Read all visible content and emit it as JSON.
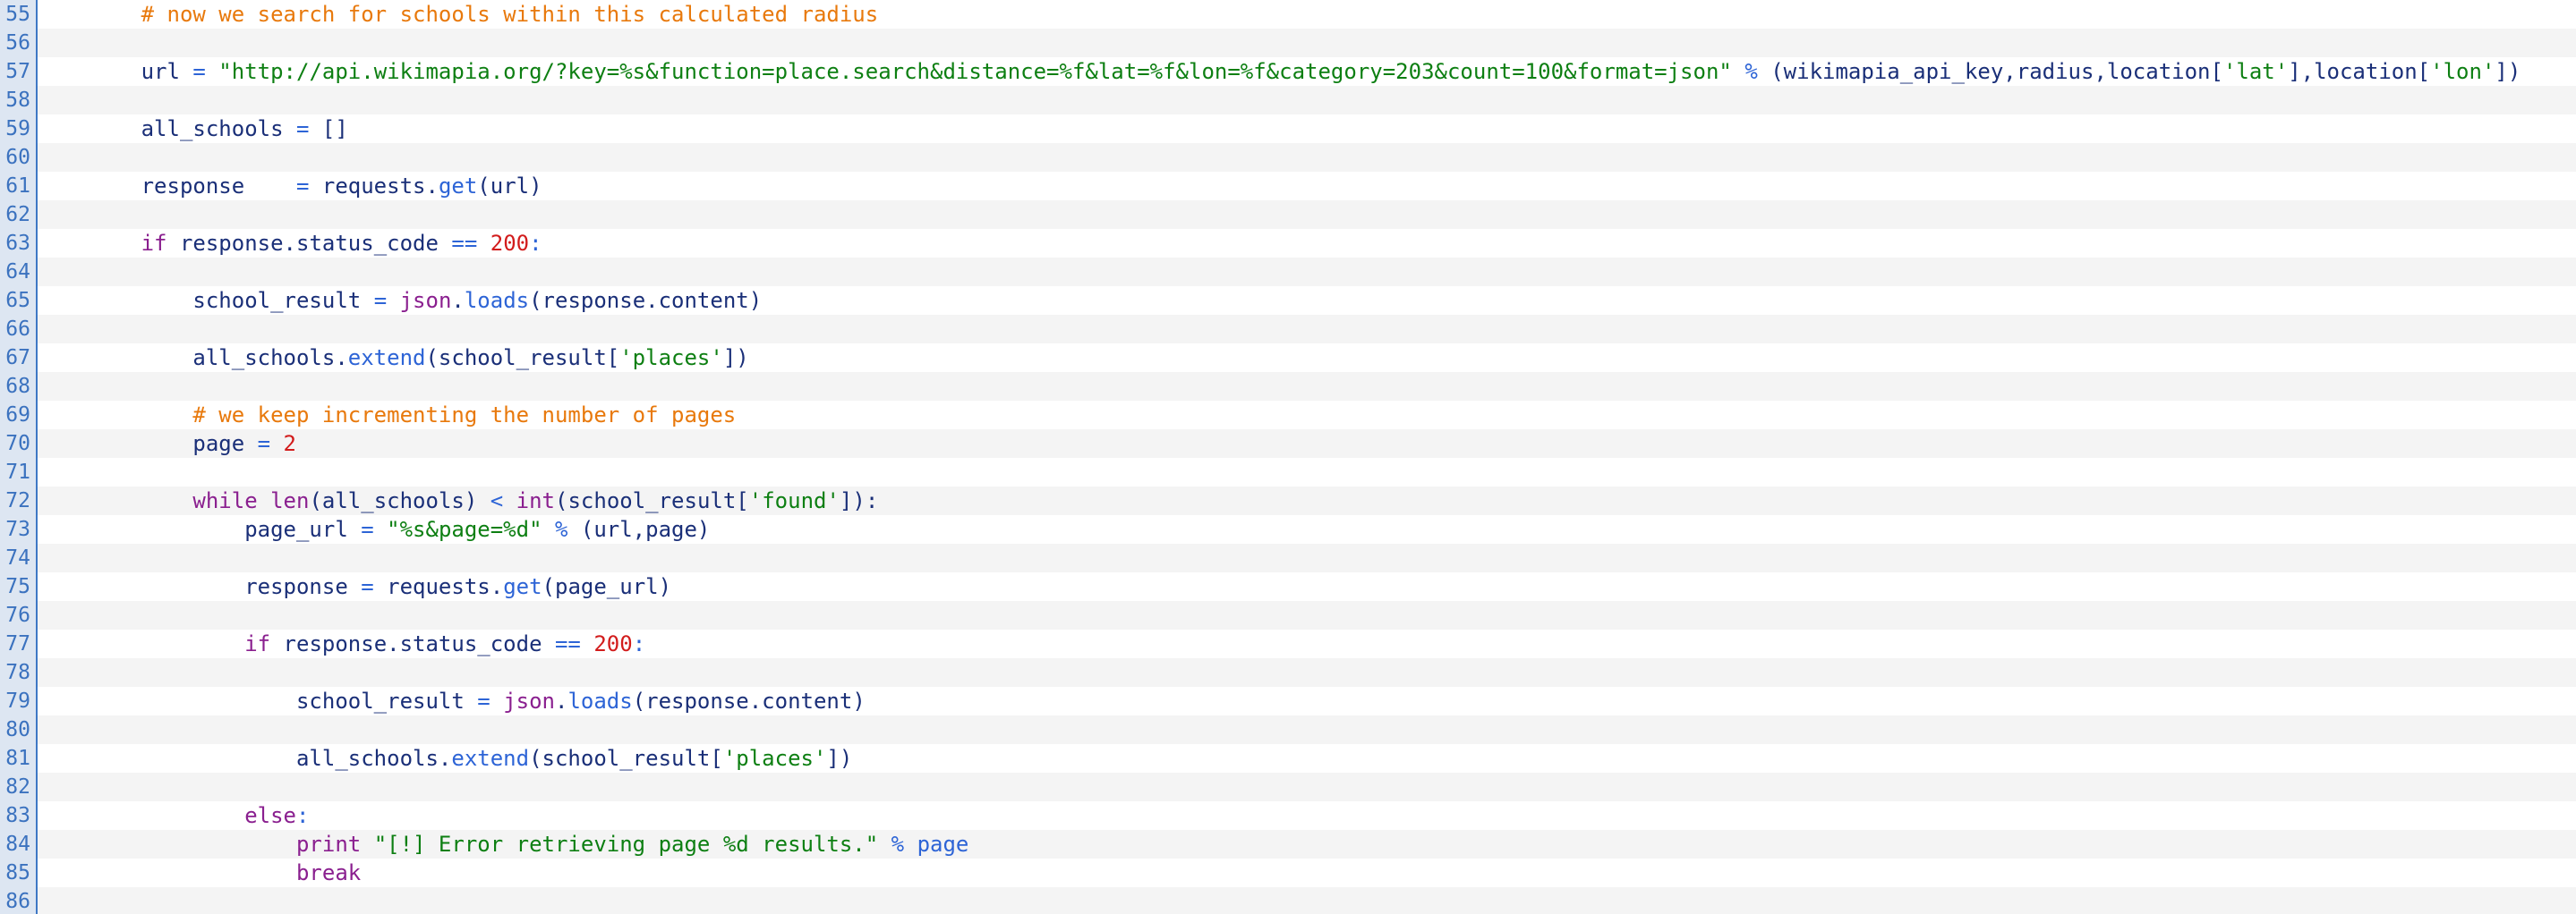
{
  "editor": {
    "lines": [
      {
        "num": "55",
        "tokens": [
          {
            "t": "        ",
            "c": "id"
          },
          {
            "t": "# now we search for schools within this calculated radius",
            "c": "comment"
          }
        ]
      },
      {
        "num": "56",
        "tokens": []
      },
      {
        "num": "57",
        "tokens": [
          {
            "t": "        ",
            "c": "id"
          },
          {
            "t": "url ",
            "c": "id"
          },
          {
            "t": "=",
            "c": "op"
          },
          {
            "t": " ",
            "c": "id"
          },
          {
            "t": "\"http://api.wikimapia.org/?key=%s&function=place.search&distance=%f&lat=%f&lon=%f&category=203&count=100&format=json\"",
            "c": "str"
          },
          {
            "t": " ",
            "c": "id"
          },
          {
            "t": "%",
            "c": "op"
          },
          {
            "t": " (wikimapia_api_key,radius,location[",
            "c": "id"
          },
          {
            "t": "'lat'",
            "c": "str"
          },
          {
            "t": "],location[",
            "c": "id"
          },
          {
            "t": "'lon'",
            "c": "str"
          },
          {
            "t": "])",
            "c": "id"
          }
        ]
      },
      {
        "num": "58",
        "tokens": []
      },
      {
        "num": "59",
        "tokens": [
          {
            "t": "        ",
            "c": "id"
          },
          {
            "t": "all_schools ",
            "c": "id"
          },
          {
            "t": "=",
            "c": "op"
          },
          {
            "t": " []",
            "c": "id"
          }
        ]
      },
      {
        "num": "60",
        "tokens": []
      },
      {
        "num": "61",
        "tokens": [
          {
            "t": "        ",
            "c": "id"
          },
          {
            "t": "response    ",
            "c": "id"
          },
          {
            "t": "=",
            "c": "op"
          },
          {
            "t": " requests.",
            "c": "id"
          },
          {
            "t": "get",
            "c": "call"
          },
          {
            "t": "(url)",
            "c": "id"
          }
        ]
      },
      {
        "num": "62",
        "tokens": []
      },
      {
        "num": "63",
        "tokens": [
          {
            "t": "        ",
            "c": "id"
          },
          {
            "t": "if",
            "c": "kw"
          },
          {
            "t": " response.status_code ",
            "c": "id"
          },
          {
            "t": "==",
            "c": "op"
          },
          {
            "t": " ",
            "c": "id"
          },
          {
            "t": "200",
            "c": "num"
          },
          {
            "t": ":",
            "c": "op"
          }
        ]
      },
      {
        "num": "64",
        "tokens": []
      },
      {
        "num": "65",
        "tokens": [
          {
            "t": "            ",
            "c": "id"
          },
          {
            "t": "school_result ",
            "c": "id"
          },
          {
            "t": "=",
            "c": "op"
          },
          {
            "t": " ",
            "c": "id"
          },
          {
            "t": "json",
            "c": "builtin"
          },
          {
            "t": ".",
            "c": "id"
          },
          {
            "t": "loads",
            "c": "call"
          },
          {
            "t": "(response.content)",
            "c": "id"
          }
        ]
      },
      {
        "num": "66",
        "tokens": []
      },
      {
        "num": "67",
        "tokens": [
          {
            "t": "            ",
            "c": "id"
          },
          {
            "t": "all_schools.",
            "c": "id"
          },
          {
            "t": "extend",
            "c": "call"
          },
          {
            "t": "(school_result[",
            "c": "id"
          },
          {
            "t": "'places'",
            "c": "str"
          },
          {
            "t": "])",
            "c": "id"
          }
        ]
      },
      {
        "num": "68",
        "tokens": []
      },
      {
        "num": "69",
        "tokens": [
          {
            "t": "            ",
            "c": "id"
          },
          {
            "t": "# we keep incrementing the number of pages",
            "c": "comment"
          }
        ]
      },
      {
        "num": "70",
        "tokens": [
          {
            "t": "            ",
            "c": "id"
          },
          {
            "t": "page ",
            "c": "id"
          },
          {
            "t": "=",
            "c": "op"
          },
          {
            "t": " ",
            "c": "id"
          },
          {
            "t": "2",
            "c": "num"
          }
        ]
      },
      {
        "num": "71",
        "tokens": []
      },
      {
        "num": "72",
        "tokens": [
          {
            "t": "            ",
            "c": "id"
          },
          {
            "t": "while",
            "c": "kw"
          },
          {
            "t": " ",
            "c": "id"
          },
          {
            "t": "len",
            "c": "builtin"
          },
          {
            "t": "(all_schools) ",
            "c": "id"
          },
          {
            "t": "<",
            "c": "op"
          },
          {
            "t": " ",
            "c": "id"
          },
          {
            "t": "int",
            "c": "builtin"
          },
          {
            "t": "(school_result[",
            "c": "id"
          },
          {
            "t": "'found'",
            "c": "str"
          },
          {
            "t": "]):",
            "c": "id"
          }
        ]
      },
      {
        "num": "73",
        "tokens": [
          {
            "t": "                ",
            "c": "id"
          },
          {
            "t": "page_url ",
            "c": "id"
          },
          {
            "t": "=",
            "c": "op"
          },
          {
            "t": " ",
            "c": "id"
          },
          {
            "t": "\"%s&page=%d\"",
            "c": "str"
          },
          {
            "t": " ",
            "c": "id"
          },
          {
            "t": "%",
            "c": "op"
          },
          {
            "t": " (url,page)",
            "c": "id"
          }
        ]
      },
      {
        "num": "74",
        "tokens": []
      },
      {
        "num": "75",
        "tokens": [
          {
            "t": "                ",
            "c": "id"
          },
          {
            "t": "response ",
            "c": "id"
          },
          {
            "t": "=",
            "c": "op"
          },
          {
            "t": " requests.",
            "c": "id"
          },
          {
            "t": "get",
            "c": "call"
          },
          {
            "t": "(page_url)",
            "c": "id"
          }
        ]
      },
      {
        "num": "76",
        "tokens": []
      },
      {
        "num": "77",
        "tokens": [
          {
            "t": "                ",
            "c": "id"
          },
          {
            "t": "if",
            "c": "kw"
          },
          {
            "t": " response.status_code ",
            "c": "id"
          },
          {
            "t": "==",
            "c": "op"
          },
          {
            "t": " ",
            "c": "id"
          },
          {
            "t": "200",
            "c": "num"
          },
          {
            "t": ":",
            "c": "op"
          }
        ]
      },
      {
        "num": "78",
        "tokens": []
      },
      {
        "num": "79",
        "tokens": [
          {
            "t": "                    ",
            "c": "id"
          },
          {
            "t": "school_result ",
            "c": "id"
          },
          {
            "t": "=",
            "c": "op"
          },
          {
            "t": " ",
            "c": "id"
          },
          {
            "t": "json",
            "c": "builtin"
          },
          {
            "t": ".",
            "c": "id"
          },
          {
            "t": "loads",
            "c": "call"
          },
          {
            "t": "(response.content)",
            "c": "id"
          }
        ]
      },
      {
        "num": "80",
        "tokens": []
      },
      {
        "num": "81",
        "tokens": [
          {
            "t": "                    ",
            "c": "id"
          },
          {
            "t": "all_schools.",
            "c": "id"
          },
          {
            "t": "extend",
            "c": "call"
          },
          {
            "t": "(school_result[",
            "c": "id"
          },
          {
            "t": "'places'",
            "c": "str"
          },
          {
            "t": "])",
            "c": "id"
          }
        ]
      },
      {
        "num": "82",
        "tokens": []
      },
      {
        "num": "83",
        "tokens": [
          {
            "t": "                ",
            "c": "id"
          },
          {
            "t": "else",
            "c": "kw"
          },
          {
            "t": ":",
            "c": "op"
          }
        ]
      },
      {
        "num": "84",
        "tokens": [
          {
            "t": "                    ",
            "c": "id"
          },
          {
            "t": "print",
            "c": "kw"
          },
          {
            "t": " ",
            "c": "id"
          },
          {
            "t": "\"[!] Error retrieving page %d results.\"",
            "c": "str"
          },
          {
            "t": " ",
            "c": "id"
          },
          {
            "t": "%",
            "c": "op"
          },
          {
            "t": " ",
            "c": "id"
          },
          {
            "t": "page",
            "c": "call"
          }
        ]
      },
      {
        "num": "85",
        "tokens": [
          {
            "t": "                    ",
            "c": "id"
          },
          {
            "t": "break",
            "c": "kw"
          }
        ]
      },
      {
        "num": "86",
        "tokens": []
      }
    ]
  },
  "colors": {
    "gutter_bg": "#dde6f2",
    "gutter_text": "#3b72bf",
    "comment": "#e8790c",
    "string": "#0d7f12",
    "number": "#d21c1c",
    "keyword": "#8a1f8f",
    "operator": "#2d64d6",
    "identifier": "#1a2f78"
  }
}
